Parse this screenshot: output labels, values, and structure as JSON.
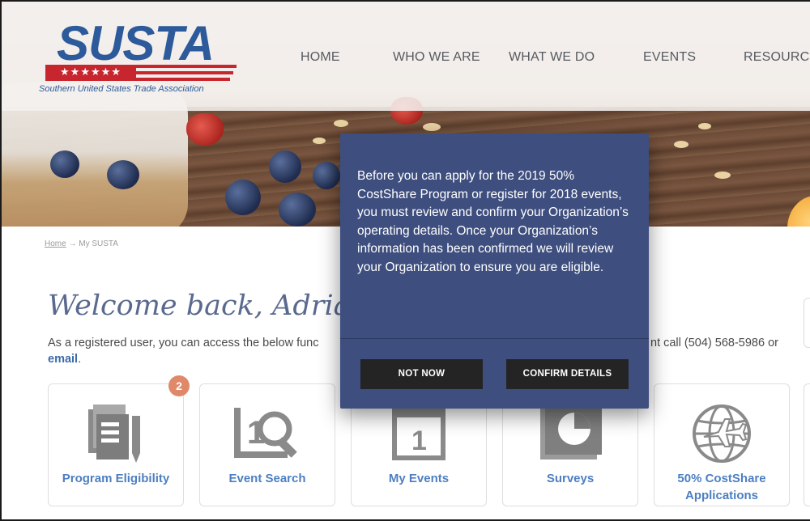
{
  "logo": {
    "wordmark": "SUSTA",
    "stars": "★★★★★★",
    "tagline": "Southern United States Trade Association"
  },
  "nav": {
    "items": [
      "HOME",
      "WHO WE ARE",
      "WHAT WE DO",
      "EVENTS",
      "RESOURCE"
    ]
  },
  "breadcrumb": {
    "home": "Home",
    "separator": "→",
    "current": "My SUSTA"
  },
  "welcome": {
    "heading": "Welcome back, Adrian",
    "intro_start": "As a registered user, you can access the below func",
    "intro_end": "nt call (504) 568-5986 or",
    "email_link": "email",
    "period": "."
  },
  "cards": [
    {
      "label": "Program Eligibility",
      "icon": "documents-icon"
    },
    {
      "label": "Event Search",
      "icon": "event-search-icon"
    },
    {
      "label": "My Events",
      "icon": "calendar-icon"
    },
    {
      "label": "Surveys",
      "icon": "survey-chart-icon"
    },
    {
      "label": "50% CostShare Applications",
      "icon": "globe-plane-icon"
    }
  ],
  "badge": {
    "count": "2",
    "color": "#e0896a"
  },
  "modal": {
    "message": "Before you can apply for the 2019 50% CostShare Program or register for 2018 events, you must review and confirm your Organization’s operating details. Once your Organization’s information has been confirmed we will review your Organization to ensure you are eligible.",
    "not_now_label": "NOT NOW",
    "confirm_label": "CONFIRM DETAILS"
  },
  "colors": {
    "brand_blue": "#2d5a9a",
    "brand_red": "#c8262f",
    "modal_bg": "#3e4e7e",
    "card_label": "#4d7fc1",
    "icon_gray": "#8a8a8a"
  }
}
